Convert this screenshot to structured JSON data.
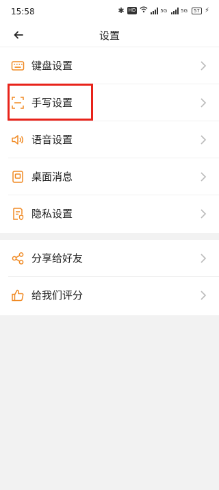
{
  "status_bar": {
    "time": "15:58",
    "hd_label": "HD",
    "signal_1_label": "5G",
    "signal_2_label": "5G",
    "battery": "57"
  },
  "header": {
    "title": "设置",
    "back_icon": "back-arrow-icon"
  },
  "settings_group_1": [
    {
      "label": "键盘设置",
      "icon": "keyboard-icon"
    },
    {
      "label": "手写设置",
      "icon": "handwriting-scan-icon",
      "highlighted": true
    },
    {
      "label": "语音设置",
      "icon": "speaker-icon"
    },
    {
      "label": "桌面消息",
      "icon": "desktop-message-icon"
    },
    {
      "label": "隐私设置",
      "icon": "privacy-document-icon"
    }
  ],
  "settings_group_2": [
    {
      "label": "分享给好友",
      "icon": "share-icon"
    },
    {
      "label": "给我们评分",
      "icon": "thumbs-up-icon"
    }
  ],
  "colors": {
    "accent": "#f08a24",
    "highlight": "#e8231a",
    "background": "#f2f2f2",
    "chevron": "#bbbbbb"
  }
}
